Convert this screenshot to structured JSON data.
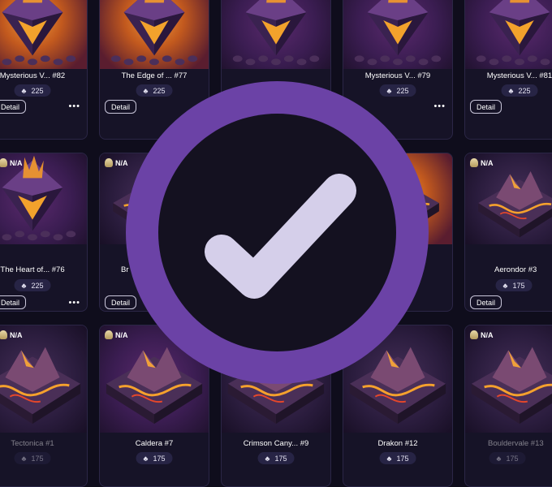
{
  "badge": {
    "icon": "checkmark-icon",
    "ring_color": "#6b42a6",
    "check_color": "#d5cfea"
  },
  "price_icon": "token-icon",
  "cards": [
    {
      "rank": "",
      "title": "Mysterious V... #82",
      "price": "225",
      "detail": "Detail",
      "more": "•••",
      "art": "crystal",
      "bg": "orange"
    },
    {
      "rank": "",
      "title": "The Edge of ... #77",
      "price": "225",
      "detail": "Detail",
      "more": "",
      "art": "crystal",
      "bg": "orange"
    },
    {
      "rank": "",
      "title": "",
      "price": "",
      "detail": "",
      "more": "",
      "art": "crystal",
      "bg": "purple"
    },
    {
      "rank": "",
      "title": "Mysterious V... #79",
      "price": "225",
      "detail": "",
      "more": "•••",
      "art": "crystal",
      "bg": "purple"
    },
    {
      "rank": "",
      "title": "Mysterious V... #81",
      "price": "225",
      "detail": "Detail",
      "more": "•••",
      "art": "crystal",
      "bg": "purple"
    },
    {
      "rank": "N/A",
      "title": "The Heart of... #76",
      "price": "225",
      "detail": "Detail",
      "more": "•••",
      "art": "crystal",
      "bg": "purple"
    },
    {
      "rank": "N/A",
      "title": "Br",
      "price": "",
      "detail": "Detail",
      "more": "",
      "art": "terrain",
      "bg": "dark"
    },
    {
      "rank": "",
      "title": "",
      "price": "",
      "detail": "",
      "more": "",
      "art": "terrain",
      "bg": "purple"
    },
    {
      "rank": "",
      "title": "",
      "price": "",
      "detail": "",
      "more": "",
      "art": "terrain",
      "bg": "orange"
    },
    {
      "rank": "N/A",
      "title": "Aerondor #3",
      "price": "175",
      "detail": "Detail",
      "more": "",
      "art": "terrain",
      "bg": "dark"
    },
    {
      "rank": "N/A",
      "title": "Tectonica #1",
      "price": "175",
      "detail": "",
      "more": "",
      "art": "terrain",
      "bg": "dark"
    },
    {
      "rank": "N/A",
      "title": "Caldera #7",
      "price": "175",
      "detail": "",
      "more": "",
      "art": "terrain",
      "bg": "purple"
    },
    {
      "rank": "",
      "title": "Crimson Cany... #9",
      "price": "175",
      "detail": "",
      "more": "",
      "art": "terrain",
      "bg": "dark"
    },
    {
      "rank": "",
      "title": "Drakon #12",
      "price": "175",
      "detail": "",
      "more": "",
      "art": "terrain",
      "bg": "dark"
    },
    {
      "rank": "N/A",
      "title": "Bouldervale #13",
      "price": "175",
      "detail": "",
      "more": "",
      "art": "terrain",
      "bg": "dark"
    }
  ]
}
